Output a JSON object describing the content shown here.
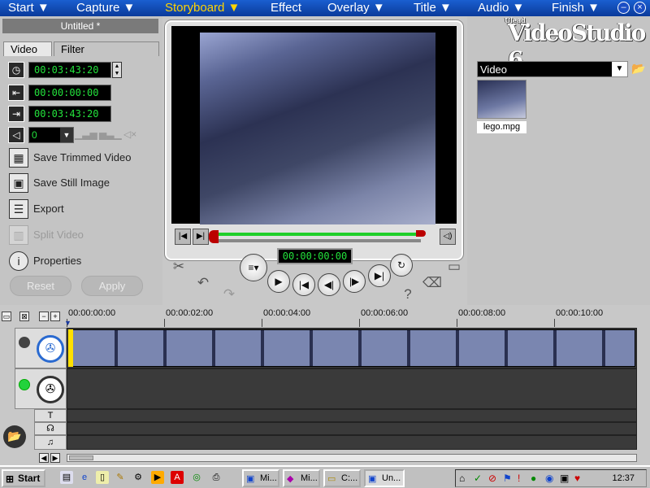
{
  "window": {
    "steps": [
      "Start",
      "Capture",
      "Storyboard",
      "Effect",
      "Overlay",
      "Title",
      "Audio",
      "Finish"
    ],
    "active_step": "Storyboard"
  },
  "left_panel": {
    "project_title": "Untitled *",
    "tabs": [
      "Video",
      "Filter"
    ],
    "duration": "00:03:43:20",
    "mark_in": "00:00:00:00",
    "mark_out": "00:03:43:20",
    "volume": "0",
    "actions": {
      "save_trimmed": "Save Trimmed Video",
      "save_still": "Save Still Image",
      "export": "Export",
      "split": "Split Video",
      "properties": "Properties"
    },
    "reset_label": "Reset",
    "apply_label": "Apply"
  },
  "player": {
    "timecode": "00:00:00:00",
    "progress": 0
  },
  "right_panel": {
    "brand": "VideoStudio",
    "brand_small": "Ulead",
    "brand_number": "6",
    "library_category": "Video",
    "clip_name": "lego.mpg"
  },
  "timeline": {
    "ruler": [
      "00:00:00:00",
      "00:00:02:00",
      "00:00:04:00",
      "00:00:06:00",
      "00:00:08:00",
      "00:00:10:00"
    ]
  },
  "taskbar": {
    "start_label": "Start",
    "tasks": [
      "Mi...",
      "Mi...",
      "C:...",
      "Un..."
    ],
    "clock": "12:37"
  },
  "colors": {
    "accent": "#ffd400",
    "timecode": "#23e23c",
    "title_bar": "#0a3a9a"
  }
}
